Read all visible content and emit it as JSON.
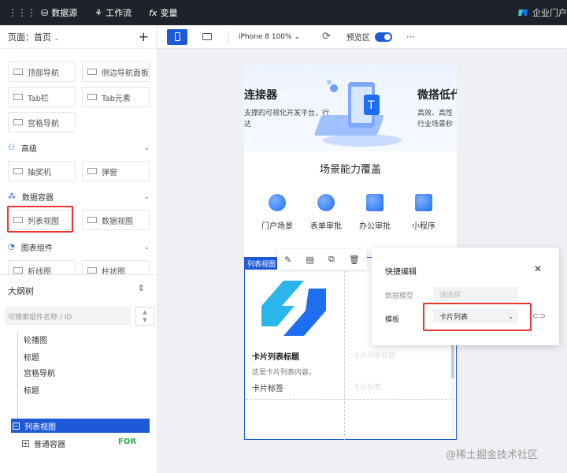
{
  "topbar": {
    "items": [
      {
        "icon": "database-icon",
        "label": "数据源"
      },
      {
        "icon": "workflow-icon",
        "label": "工作流"
      },
      {
        "icon": "fx",
        "label": "变量"
      }
    ],
    "brand": "企业门户"
  },
  "left": {
    "page_label": "页面：首页",
    "nav_buttons": [
      "顶部导航",
      "侧边导航面板",
      "Tab栏",
      "Tab元素",
      "宫格导航"
    ],
    "sections": [
      {
        "label": "高级",
        "buttons": [
          "抽奖机",
          "弹窗"
        ]
      },
      {
        "label": "数据容器",
        "buttons": [
          "列表视图",
          "数据视图"
        ]
      },
      {
        "label": "图表组件",
        "buttons": [
          "折线图",
          "柱状图"
        ]
      }
    ]
  },
  "outline": {
    "title": "大纲树",
    "search_placeholder": "可搜索组件名称 / ID",
    "items": [
      "轮播图",
      "标题",
      "宫格导航",
      "标题"
    ],
    "selected": "列表视图",
    "child": "普通容器",
    "child_tag": "FOR"
  },
  "toolbar": {
    "device": "iPhone 8 100%",
    "preview_label": "预览区",
    "preview_on": true
  },
  "canvas": {
    "banner_left": {
      "title": "连接器",
      "line1": "支撑的可视化开发平台，行",
      "line2": "达"
    },
    "banner_right": {
      "title": "微搭低代",
      "line1": "高效、高性",
      "line2": "行业场景秒"
    },
    "scene_title": "场景能力覆盖",
    "scenes": [
      "门户场景",
      "表单审批",
      "办公审批",
      "小程序"
    ],
    "list_tag": "列表视图",
    "card": {
      "title": "卡片列表标题",
      "desc": "这是卡片列表内容。",
      "tag": "卡片标签"
    }
  },
  "quick_edit": {
    "title": "快捷编辑",
    "model_label": "数据模型",
    "model_placeholder": "请选择",
    "template_label": "模板",
    "template_value": "卡片列表"
  },
  "watermark": "@稀土掘金技术社区"
}
